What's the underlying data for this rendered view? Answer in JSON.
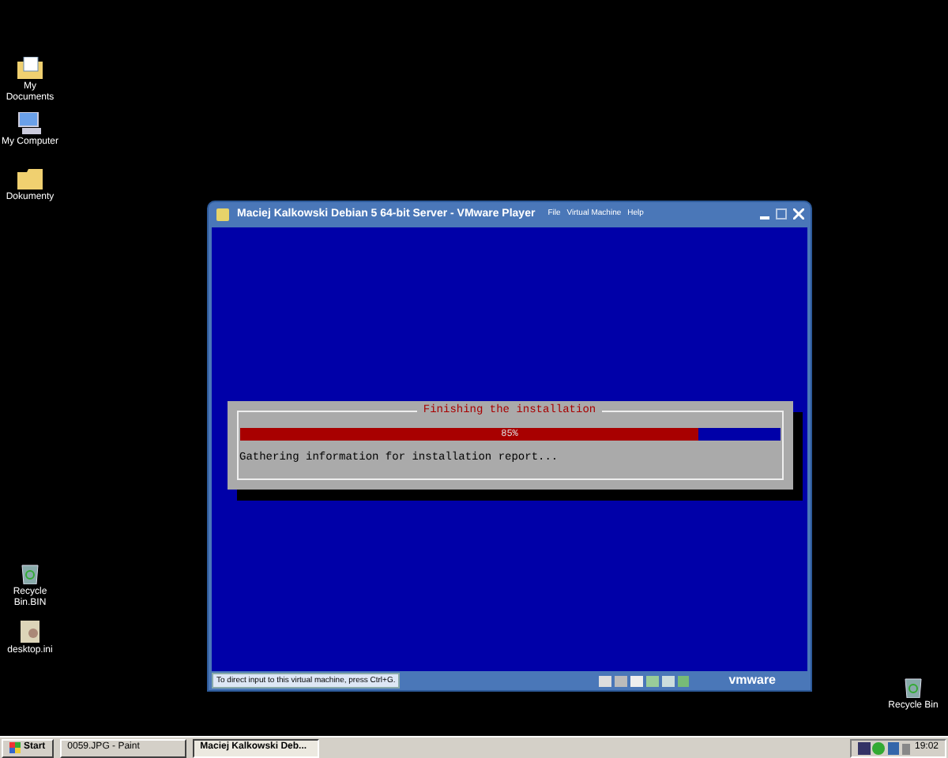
{
  "desktop_icons": [
    {
      "label": "My Documents",
      "kind": "folder-docs"
    },
    {
      "label": "My Computer",
      "kind": "computer"
    },
    {
      "label": "Dokumenty",
      "kind": "folder"
    },
    {
      "label": "Recycle Bin.BIN",
      "kind": "bin"
    },
    {
      "label": "desktop.ini",
      "kind": "file"
    },
    {
      "label": "Recycle Bin",
      "kind": "bin"
    }
  ],
  "vm_window": {
    "title": "Maciej Kalkowski Debian 5 64-bit Server - VMware Player",
    "menus": [
      "File",
      "Virtual Machine",
      "Help"
    ],
    "status_text": "To direct input to this virtual machine, press Ctrl+G.",
    "brand": "vmware"
  },
  "installer": {
    "title": "Finishing the installation",
    "progress": {
      "level": 0.85,
      "reading": "85%"
    },
    "message": "Gathering information for installation report..."
  },
  "taskbar": {
    "start": "Start",
    "tasks": [
      {
        "label": "0059.JPG - Paint",
        "selected": false
      },
      {
        "label": "Maciej Kalkowski Deb...",
        "selected": true
      }
    ],
    "clock": "19:02"
  }
}
